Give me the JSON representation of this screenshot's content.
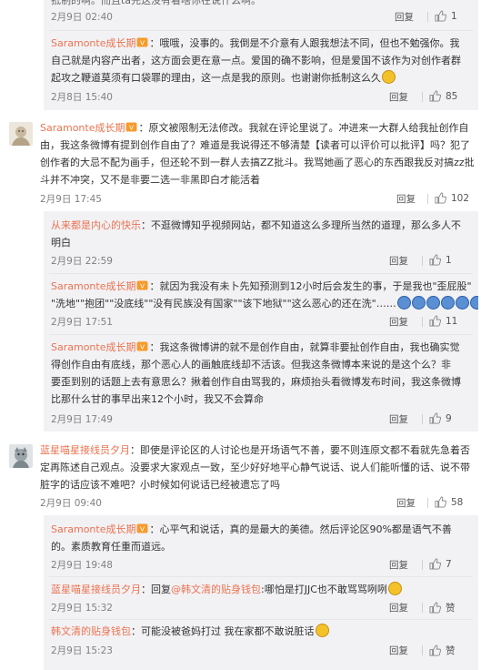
{
  "c0": {
    "text_line": "抵制的啊。而且ta先这没有看啥你在说什么啊。",
    "time": "2月9日 02:40",
    "reply": "回复",
    "likes": "1",
    "sub": {
      "user": "Saramonte成长期",
      "l1": "：哦哦，没事的。我倒是不介意有人跟我想法不同，但也不勉强你。我",
      "l2": "自己就是内容产出者，这方面会更在意一点。爱国的确不影响，但是爱国不该作为对创作者群",
      "l3": "起攻之鞭道莫须有口袋罪的理由，这一点是我的原则。也谢谢你抵制这么久",
      "time": "2月8日 15:40",
      "reply": "回复",
      "likes": "85"
    }
  },
  "c1": {
    "user": "Saramonte成长期",
    "l1": "：原文被限制无法修改。我就在评论里说了。冲进来一大群人给我扯创作自",
    "l2": "由，我这条微博有提到创作自由了？难道是我说得还不够清楚【读者可以评价可以批评】吗？犯了",
    "l3": "创作者的大忌不配为画手，但还轮不到一群人去搞ZZ批斗。我骂她画了恶心的东西跟我反对搞zz批",
    "l4": "斗并不冲突，又不是非要二选一非黑即白才能活着",
    "time": "2月9日 17:45",
    "reply": "回复",
    "likes": "102",
    "replies": [
      {
        "user": "从来都是内心的快乐",
        "l1": "：不逛微博知乎视频网站，都不知道这么多理所当然的道理，那么多人不",
        "l2": "明白",
        "time": "2月9日 22:59",
        "reply": "回复",
        "likes": "1"
      },
      {
        "user": "Saramonte成长期",
        "l1": "：就因为我没有未卜先知预测到12小时后会发生的事，于是我也\"歪屁股\"",
        "l2": "\"洗地\"\"抱团\"\"没底线\"\"没有民族没有国家\"\"该下地狱\"\"这么恶心的还在洗\"……",
        "time": "2月9日 17:51",
        "reply": "回复",
        "likes": "11"
      },
      {
        "user": "Saramonte成长期",
        "l1": "：我这条微博讲的就不是创作自由，就算非要扯创作自由，我也确实觉",
        "l2": "得创作自由有底线，那个恶心人的画触底线却不活该。但我这条微博本来说的是这个么？非",
        "l3": "要歪到别的话题上去有意思么？揪着创作自由骂我的，麻烦抬头看微博发布时间，我这条微博",
        "l4": "比那什么甘的事早出来12个小时，我又不会算命",
        "time": "2月9日 17:49",
        "reply": "回复",
        "likes": "9"
      }
    ]
  },
  "c2": {
    "user": "蓝星喵星接线员夕月",
    "l1": "：即使是评论区的人讨论也是开场语气不善，要不则连原文都不看就先急着否",
    "l2": "定再陈述自己观点。没要求大家观点一致，至少好好地平心静气说话、说人们能听懂的话、说不带",
    "l3": "脏字的话应该不难吧？小时候如何说话已经被遗忘了吗",
    "time": "2月9日 09:40",
    "reply": "回复",
    "likes": "58",
    "replies": [
      {
        "user": "Saramonte成长期",
        "l1": "：心平气和说话，真的是最大的美德。然后评论区90%都是语气不善",
        "l2": "的。素质教育任重而道远。",
        "time": "2月9日 19:48",
        "reply": "回复",
        "likes": "7"
      },
      {
        "user": "蓝星喵星接线员夕月",
        "pre": "：回复",
        "mention": "@韩文清的贴身钱包",
        "post": ":哪怕是打JJC也不敢骂骂咧咧",
        "time": "2月9日 15:32",
        "reply": "回复",
        "likes": "赞"
      },
      {
        "user": "韩文清的贴身钱包",
        "l1": "：可能没被爸妈打过 我在家都不敢说脏话",
        "time": "2月9日 15:23",
        "reply": "回复",
        "likes": "赞"
      }
    ]
  },
  "icons": {
    "thumb": "thumbs-up-icon",
    "badge": "growth-badge-icon"
  }
}
